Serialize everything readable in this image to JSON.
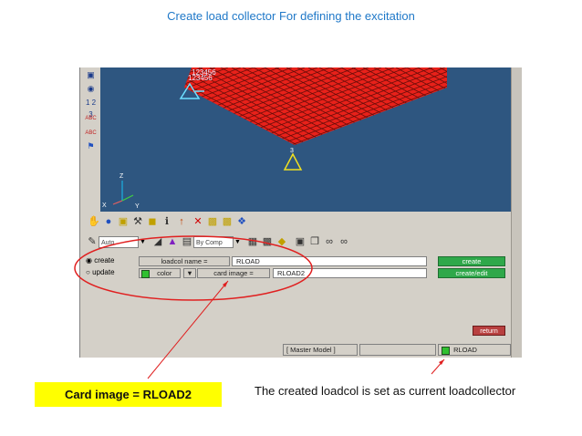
{
  "slide": {
    "title": "Create load collector For defining the excitation",
    "callout_label": "Card image = RLOAD2",
    "note": "The created  loadcol is set as current loadcollector"
  },
  "left_toolbar": {
    "icons": [
      "cube-icon",
      "binoculars-icon",
      "numbering-icon",
      "abc-icon",
      "abc-marker-icon",
      "flag-icon"
    ],
    "numbering_text": "1 2 3",
    "abc1": "ABC",
    "abc2": "ABC"
  },
  "viewport": {
    "node_labels": [
      "123456",
      "123456"
    ],
    "triad_labels": {
      "z": "Z",
      "x": "X",
      "y": "Y"
    },
    "marker_label": "3",
    "mesh_color": "#e8211a",
    "background_color": "#2e5680"
  },
  "toolbar": {
    "display_mode": "Auto",
    "color_mode": "By Comp"
  },
  "panel": {
    "radio_create": "create",
    "radio_update": "update",
    "name_label": "loadcol name =",
    "name_value": "RLOAD",
    "color_label": "color",
    "card_image_label": "card image =",
    "card_image_value": "RLOAD2",
    "create_button": "create",
    "create_edit_button": "create/edit",
    "return_button": "return"
  },
  "statusbar": {
    "model": "[ Master Model ]",
    "current_collector": "RLOAD"
  },
  "colors": {
    "title_blue": "#1f78c8",
    "callout_yellow": "#ffff00",
    "annotation_red": "#e02020",
    "action_green": "#2fa84a"
  }
}
